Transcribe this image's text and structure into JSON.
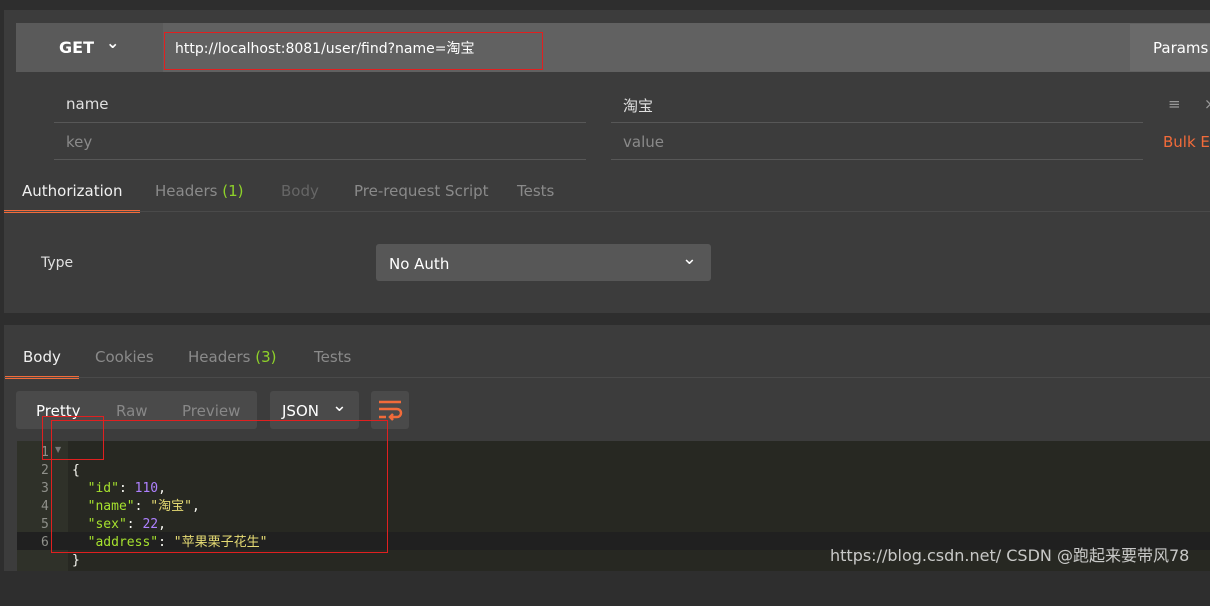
{
  "request": {
    "method": "GET",
    "url": "http://localhost:8081/user/find?name=淘宝",
    "params_button": "Params",
    "params": [
      {
        "key": "name",
        "value": "淘宝"
      }
    ],
    "key_placeholder": "key",
    "value_placeholder": "value",
    "bulk_edit": "Bulk Edit",
    "tabs": [
      {
        "label": "Authorization",
        "active": true
      },
      {
        "label": "Headers",
        "count": "(1)"
      },
      {
        "label": "Body",
        "disabled": true
      },
      {
        "label": "Pre-request Script"
      },
      {
        "label": "Tests"
      }
    ],
    "auth": {
      "type_label": "Type",
      "type_value": "No Auth"
    }
  },
  "response": {
    "tabs": [
      {
        "label": "Body",
        "active": true
      },
      {
        "label": "Cookies"
      },
      {
        "label": "Headers",
        "count": "(3)"
      },
      {
        "label": "Tests"
      }
    ],
    "views": [
      "Pretty",
      "Raw",
      "Preview"
    ],
    "format": "JSON",
    "lines": [
      "1",
      "2",
      "3",
      "4",
      "5",
      "6"
    ],
    "json": {
      "id_key": "\"id\"",
      "id_val": "110",
      "name_key": "\"name\"",
      "name_val": "\"淘宝\"",
      "sex_key": "\"sex\"",
      "sex_val": "22",
      "address_key": "\"address\"",
      "address_val": "\"苹果栗子花生\""
    }
  },
  "watermark": "https://blog.csdn.net/ CSDN @跑起来要带风78",
  "colors": {
    "accent": "#f26b3a",
    "count": "#8ed12a",
    "highlight": "#e02020"
  }
}
